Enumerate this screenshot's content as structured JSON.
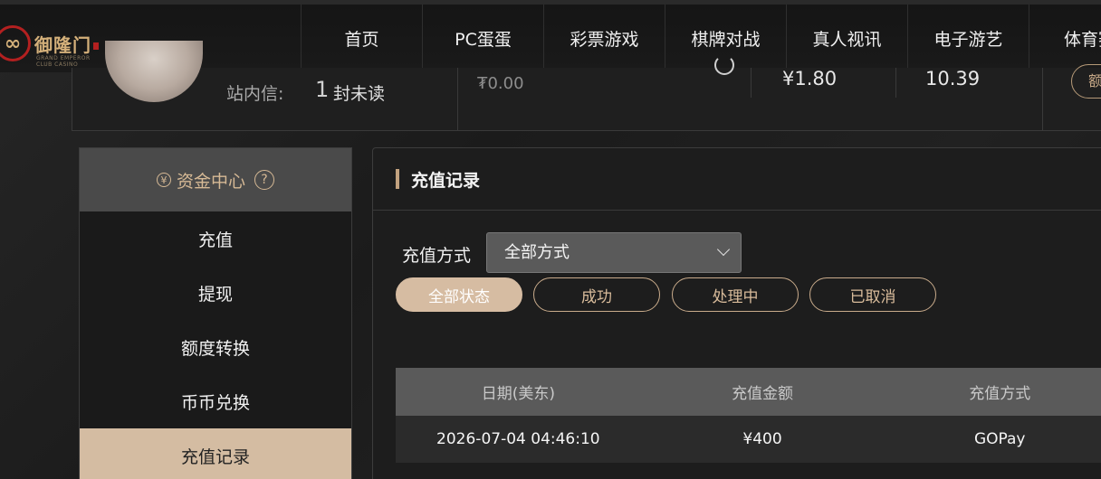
{
  "brand": {
    "logo_text": "御隆门",
    "logo_sub": "GRAND EMPEROR CLUB CASINO"
  },
  "nav": [
    "首页",
    "PC蛋蛋",
    "彩票游戏",
    "棋牌对战",
    "真人视讯",
    "电子游艺",
    "体育赛"
  ],
  "user": {
    "msg_label": "站内信:",
    "msg_count": "1",
    "msg_unit": "封未读",
    "balance_main": "₮0.00",
    "balance_a": "¥1.80",
    "balance_b": "10.39",
    "edge_button": "额"
  },
  "sidebar": {
    "header": "资金中心",
    "yen_symbol": "¥",
    "help_symbol": "?",
    "items": [
      "充值",
      "提现",
      "额度转换",
      "币币兑换",
      "充值记录"
    ]
  },
  "panel": {
    "title": "充值记录",
    "filter_label": "充值方式",
    "filter_value": "全部方式",
    "statuses": [
      "全部状态",
      "成功",
      "处理中",
      "已取消"
    ],
    "table": {
      "headers": [
        "日期(美东)",
        "充值金额",
        "充值方式"
      ],
      "rows": [
        [
          "2026-07-04 04:46:10",
          "¥400",
          "GOPay"
        ]
      ]
    }
  }
}
